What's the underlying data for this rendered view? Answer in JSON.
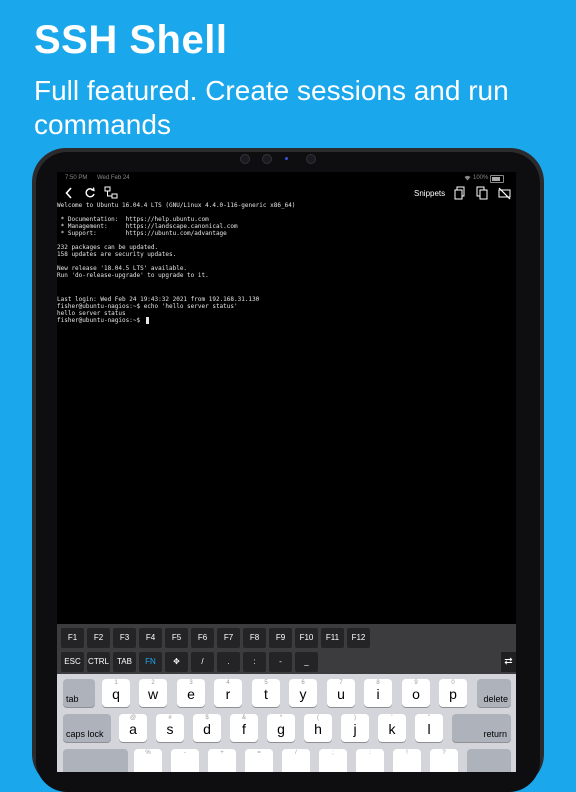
{
  "promo": {
    "headline": "SSH Shell",
    "subhead": "Full featured. Create sessions and run commands"
  },
  "status_bar": {
    "time": "7:50 PM",
    "date": "Wed Feb 24",
    "battery": "100%"
  },
  "toolbar": {
    "back_icon": "chevron-left-icon",
    "refresh_icon": "refresh-icon",
    "network_icon": "network-icon",
    "snippets_label": "Snippets",
    "copy_icon": "copy-icon",
    "duplicate_icon": "duplicate-icon",
    "hide_keyboard_icon": "hide-keyboard-icon"
  },
  "terminal": {
    "lines": [
      "Welcome to Ubuntu 16.04.4 LTS (GNU/Linux 4.4.0-116-generic x86_64)",
      "",
      " * Documentation:  https://help.ubuntu.com",
      " * Management:     https://landscape.canonical.com",
      " * Support:        https://ubuntu.com/advantage",
      "",
      "232 packages can be updated.",
      "158 updates are security updates.",
      "",
      "New release '18.04.5 LTS' available.",
      "Run 'do-release-upgrade' to upgrade to it.",
      "",
      "",
      "Last login: Wed Feb 24 19:43:32 2021 from 192.168.31.130",
      "fisher@ubuntu-nagios:~$ echo 'hello server status'",
      "hello server status",
      "fisher@ubuntu-nagios:~$"
    ]
  },
  "accessory_keys": {
    "function_row": [
      "F1",
      "F2",
      "F3",
      "F4",
      "F5",
      "F6",
      "F7",
      "F8",
      "F9",
      "F10",
      "F11",
      "F12"
    ],
    "control_row": [
      "ESC",
      "CTRL",
      "TAB",
      "FN",
      "✥",
      "/",
      ".",
      ":",
      "-",
      "_"
    ],
    "swap_label": "⇄"
  },
  "keyboard": {
    "tab_label": "tab",
    "delete_label": "delete",
    "caps_label": "caps lock",
    "return_label": "return",
    "row1": [
      {
        "main": "q",
        "alt": "1"
      },
      {
        "main": "w",
        "alt": "2"
      },
      {
        "main": "e",
        "alt": "3"
      },
      {
        "main": "r",
        "alt": "4"
      },
      {
        "main": "t",
        "alt": "5"
      },
      {
        "main": "y",
        "alt": "6"
      },
      {
        "main": "u",
        "alt": "7"
      },
      {
        "main": "i",
        "alt": "8"
      },
      {
        "main": "o",
        "alt": "9"
      },
      {
        "main": "p",
        "alt": "0"
      }
    ],
    "row2": [
      {
        "main": "a",
        "alt": "@"
      },
      {
        "main": "s",
        "alt": "#"
      },
      {
        "main": "d",
        "alt": "$"
      },
      {
        "main": "f",
        "alt": "&"
      },
      {
        "main": "g",
        "alt": "*"
      },
      {
        "main": "h",
        "alt": "("
      },
      {
        "main": "j",
        "alt": ")"
      },
      {
        "main": "k",
        "alt": "'"
      },
      {
        "main": "l",
        "alt": "\""
      }
    ],
    "row3": [
      {
        "main": "",
        "alt": "%"
      },
      {
        "main": "",
        "alt": "-"
      },
      {
        "main": "",
        "alt": "+"
      },
      {
        "main": "",
        "alt": "="
      },
      {
        "main": "",
        "alt": "/"
      },
      {
        "main": "",
        "alt": ";"
      },
      {
        "main": "",
        "alt": ":"
      },
      {
        "main": "",
        "alt": "!"
      },
      {
        "main": "",
        "alt": "?"
      }
    ]
  }
}
